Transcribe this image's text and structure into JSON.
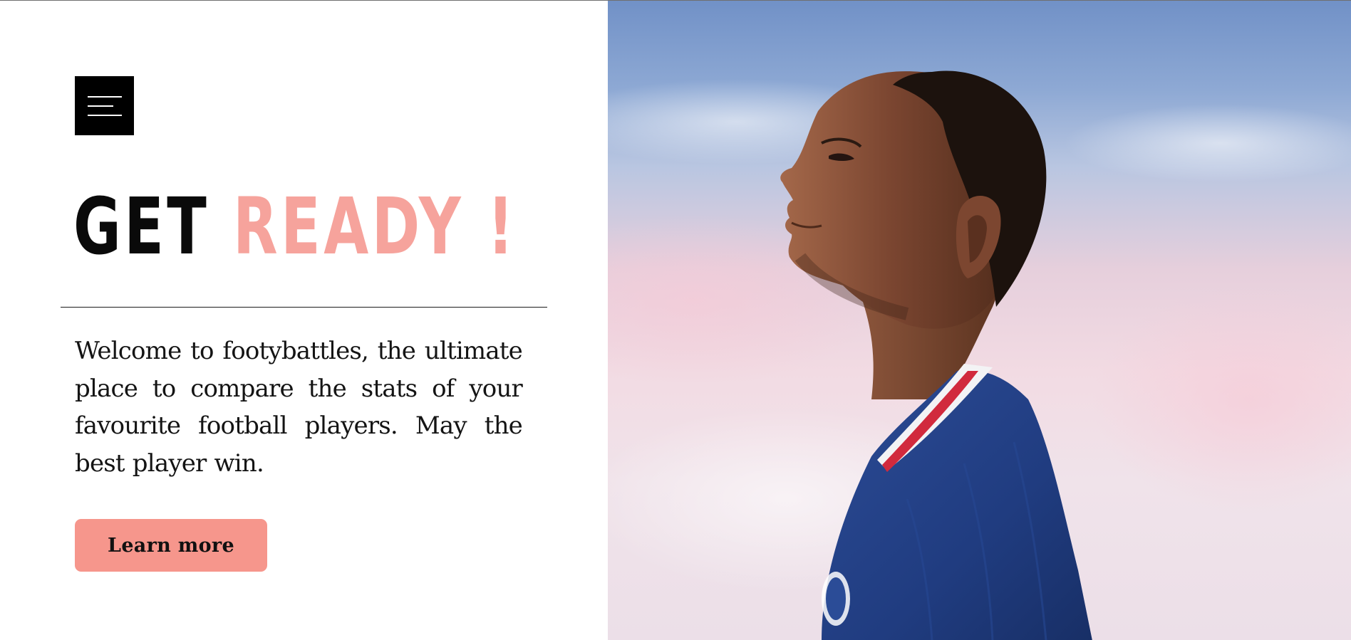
{
  "menu": {
    "icon": "hamburger-menu-icon",
    "label": "Menu"
  },
  "headline": {
    "part1": "GET",
    "part2": "READY !"
  },
  "intro": {
    "text": "Welcome to footybattles, the ultimate place to compare the stats of your favourite football players. May the best player win."
  },
  "cta": {
    "label": "Learn more"
  },
  "hero": {
    "image": "football-player-profile-photo"
  },
  "colors": {
    "accent": "#f6a39c",
    "button": "#f6968c",
    "text": "#141414",
    "dark": "#000000",
    "jersey": "#1f3a7a",
    "sky_top": "#7191c7",
    "sky_bottom": "#ecdfe8"
  }
}
